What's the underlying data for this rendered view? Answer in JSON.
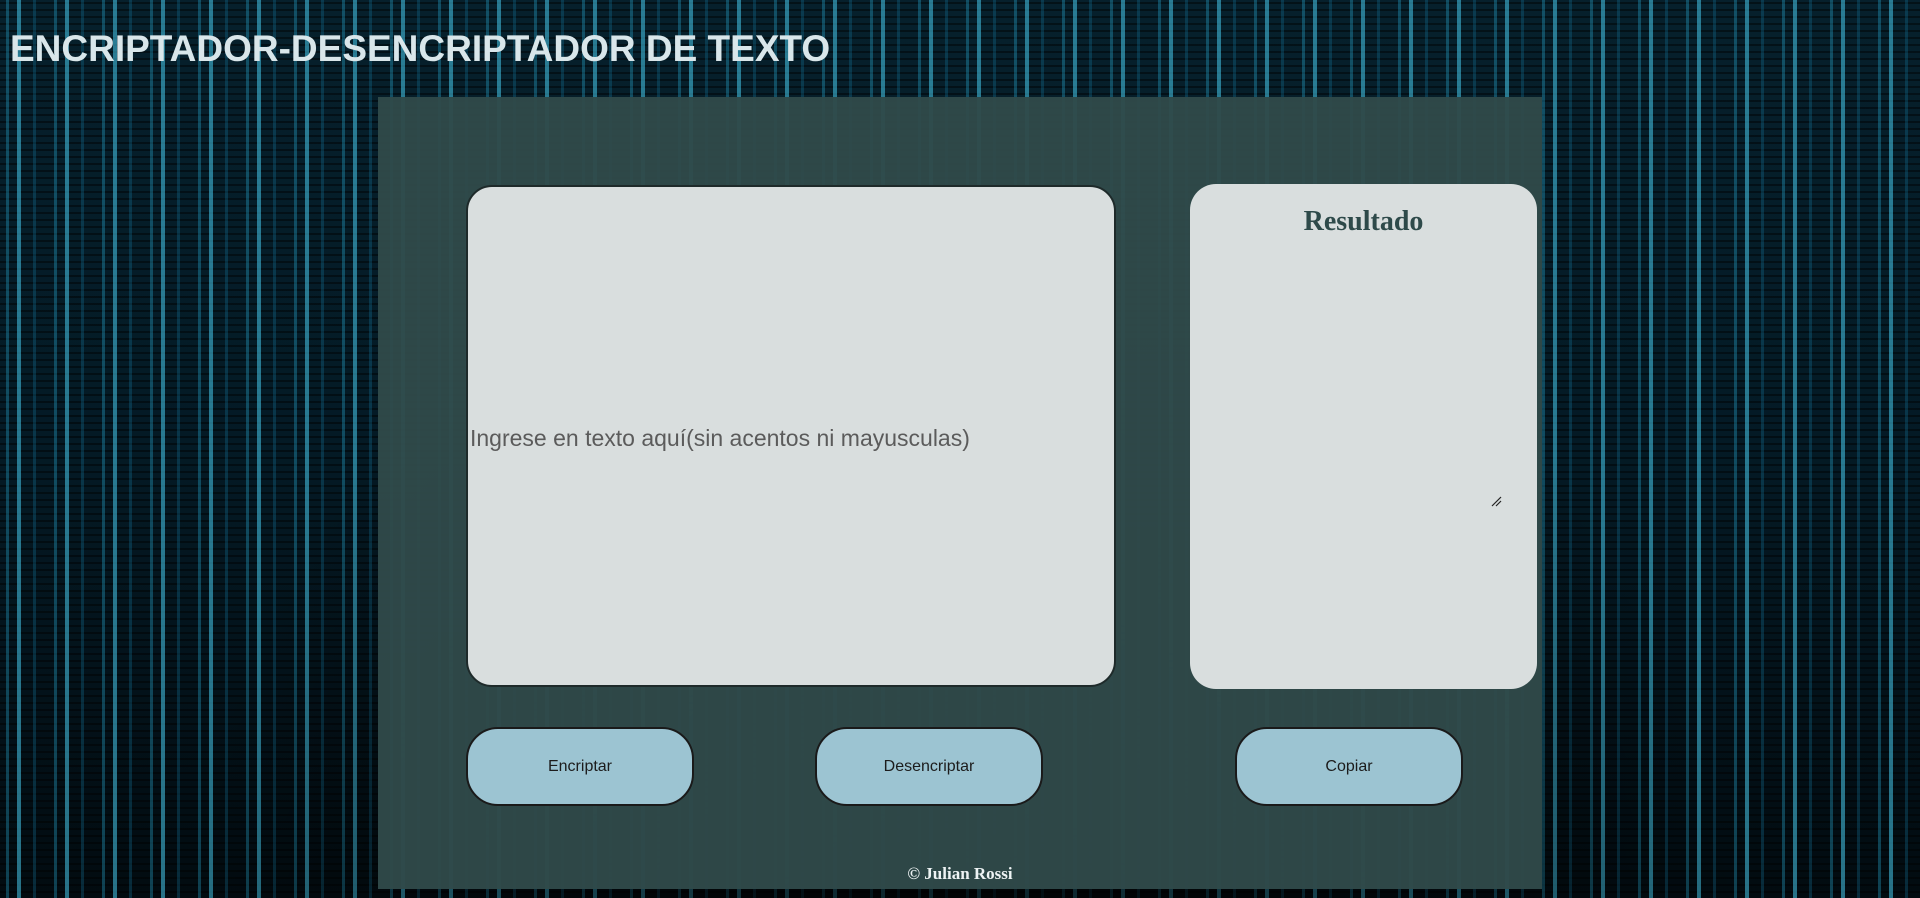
{
  "header": {
    "title": "ENCRIPTADOR-DESENCRIPTADOR DE TEXTO"
  },
  "input": {
    "value": "",
    "placeholder": "Ingrese en texto aquí(sin acentos ni mayusculas)"
  },
  "result": {
    "title": "Resultado",
    "value": ""
  },
  "buttons": {
    "encrypt_label": "Encriptar",
    "decrypt_label": "Desencriptar",
    "copy_label": "Copiar"
  },
  "footer": {
    "text": "© Julian Rossi"
  },
  "colors": {
    "panel": "#304a4a",
    "button": "#9cc4d2",
    "text_area": "#e6e9ea",
    "result_title": "#2e4a4a",
    "background_matrix": "#46c8eb"
  },
  "icons": {
    "resize_handle": "resize-grip-icon"
  }
}
